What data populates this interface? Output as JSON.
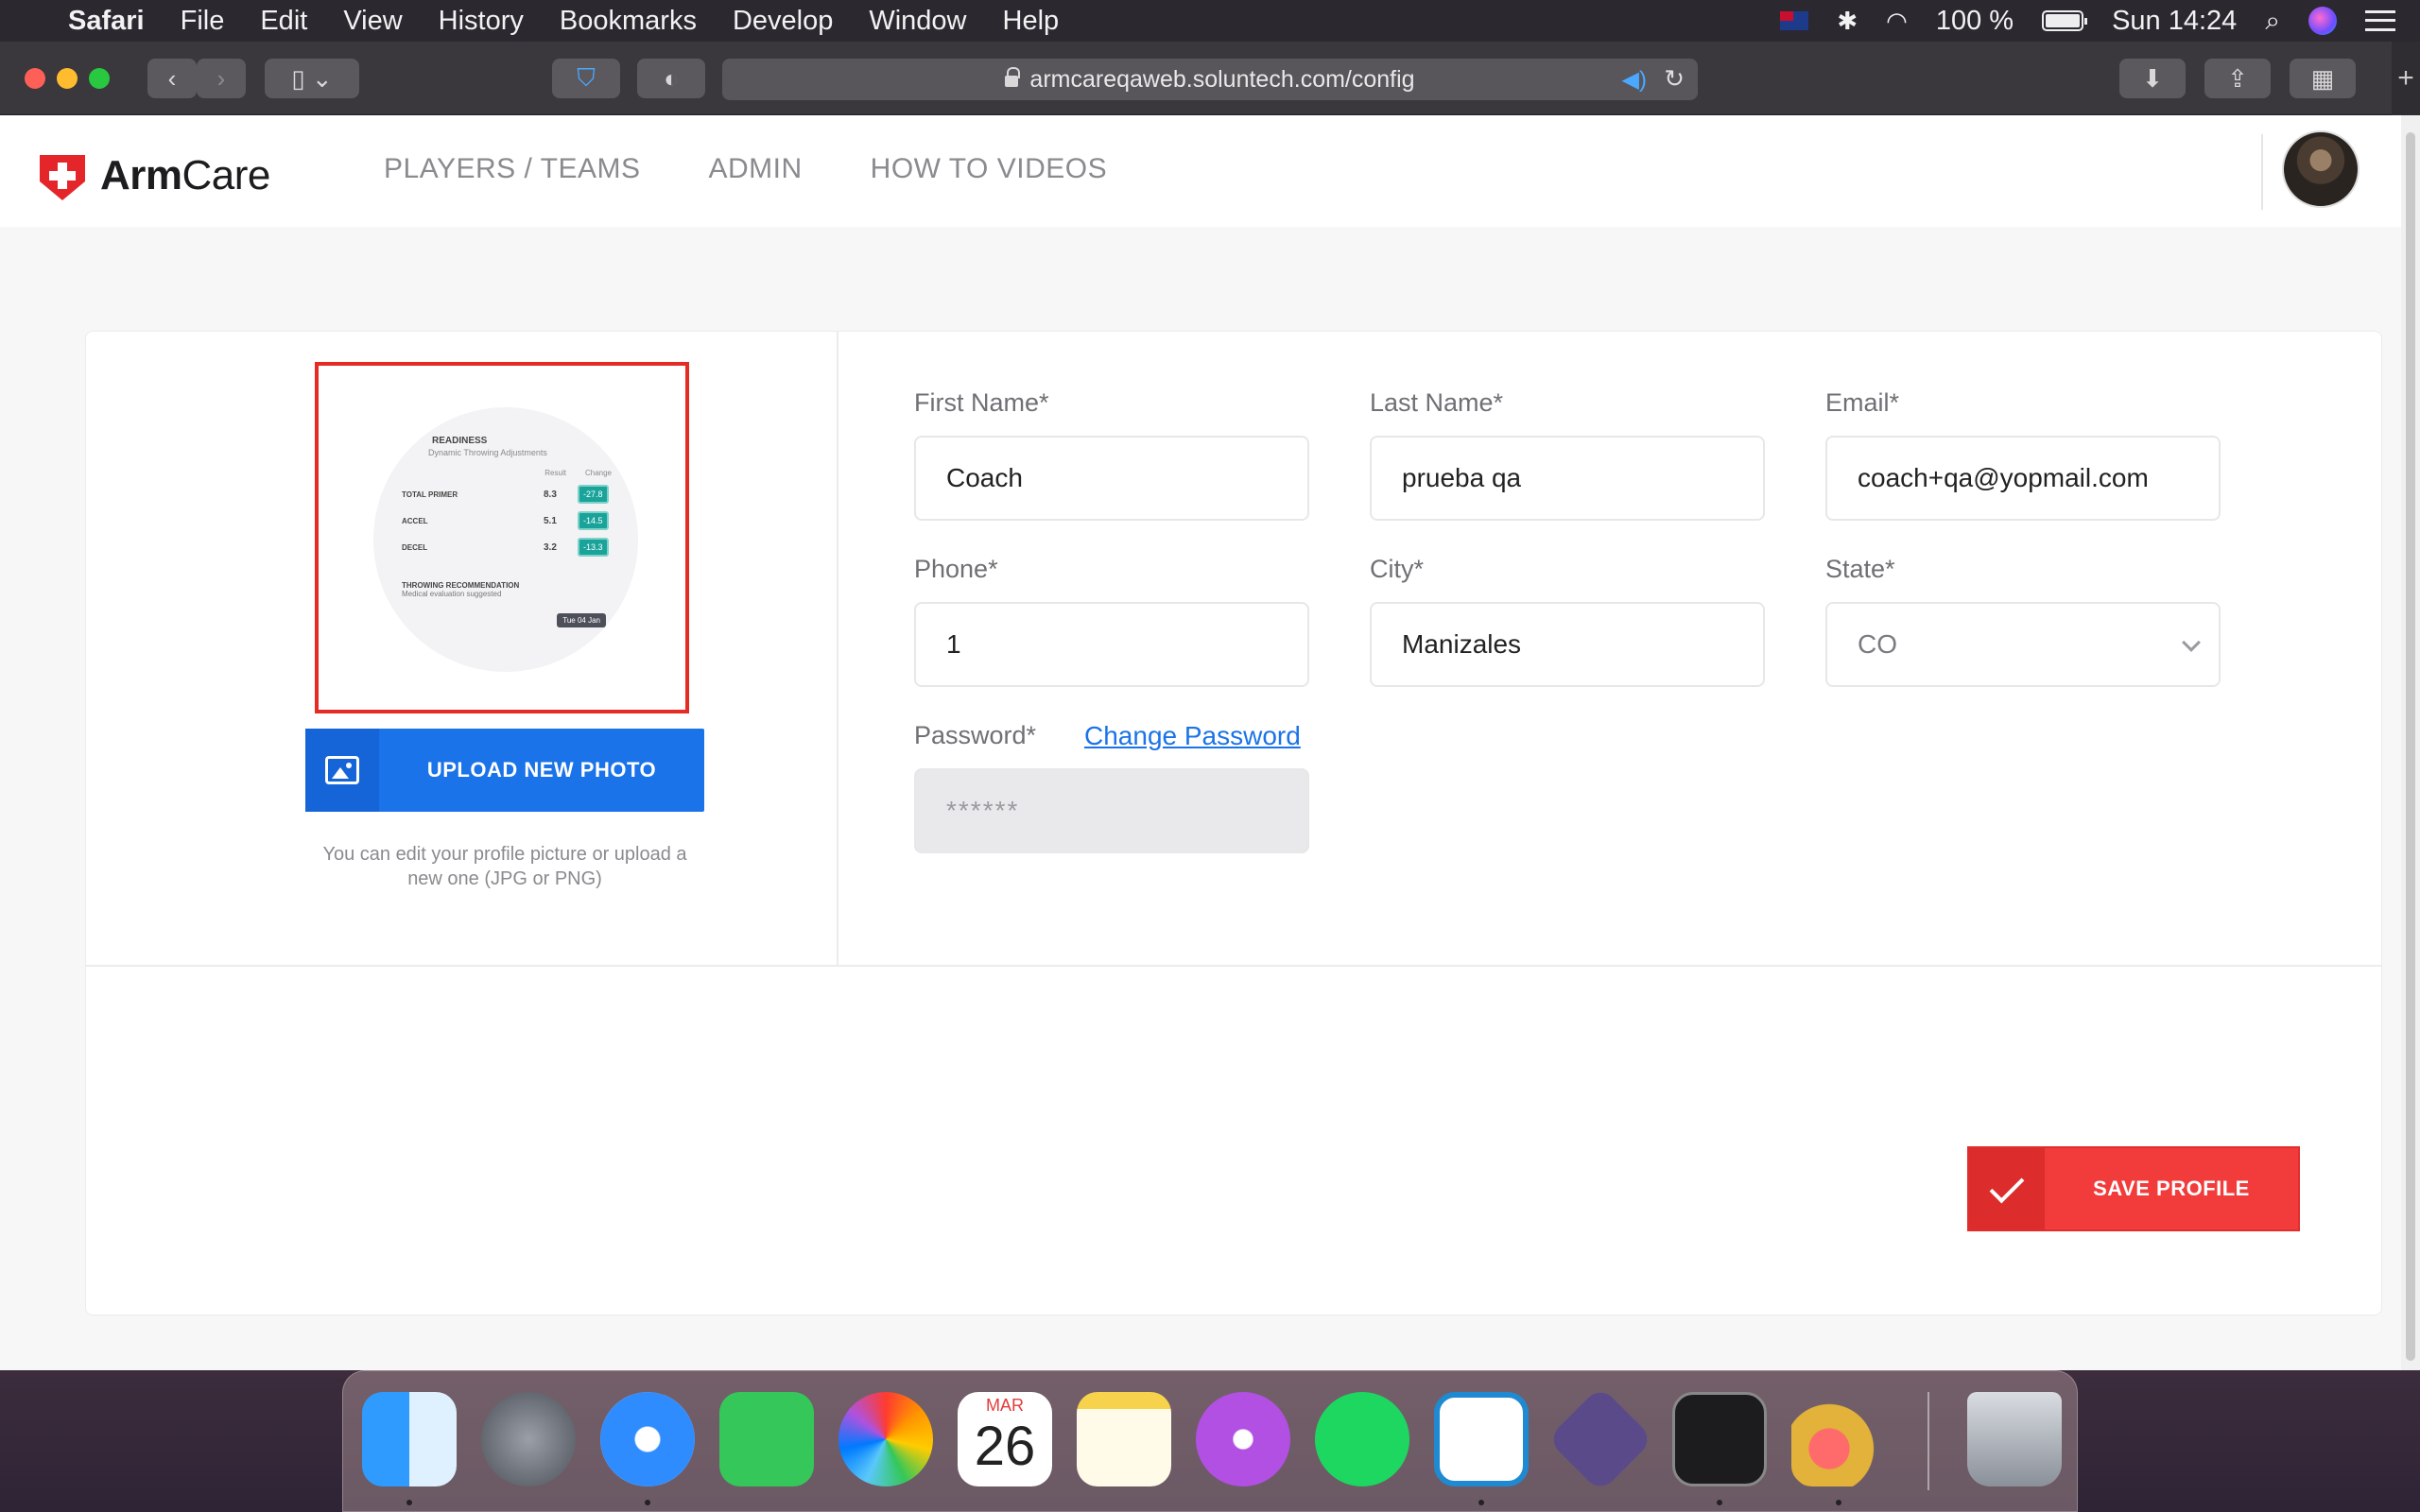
{
  "menubar": {
    "app_name": "Safari",
    "items": [
      "File",
      "Edit",
      "View",
      "History",
      "Bookmarks",
      "Develop",
      "Window",
      "Help"
    ],
    "battery": "100 %",
    "clock": "Sun 14:24"
  },
  "browser": {
    "url": "armcareqaweb.soluntech.com/config"
  },
  "app": {
    "brand_bold": "Arm",
    "brand_light": "Care",
    "nav": [
      "PLAYERS / TEAMS",
      "ADMIN",
      "HOW TO VIDEOS"
    ]
  },
  "profile_photo": {
    "title": "READINESS",
    "subtitle": "Dynamic Throwing Adjustments",
    "col_result": "Result",
    "col_change": "Change",
    "rows": [
      {
        "label": "TOTAL PRIMER",
        "value": "8.3",
        "change": "-27.8"
      },
      {
        "label": "ACCEL",
        "value": "5.1",
        "change": "-14.5"
      },
      {
        "label": "DECEL",
        "value": "3.2",
        "change": "-13.3"
      }
    ],
    "recommendation": "THROWING RECOMMENDATION",
    "recommendation_detail": "Medical evaluation suggested",
    "date": "Tue 04 Jan"
  },
  "upload": {
    "button_label": "UPLOAD NEW PHOTO",
    "hint": "You can edit your profile picture or upload a new one (JPG or PNG)"
  },
  "form": {
    "first_name": {
      "label": "First Name*",
      "value": "Coach"
    },
    "last_name": {
      "label": "Last Name*",
      "value": "prueba qa"
    },
    "email": {
      "label": "Email*",
      "value": "coach+qa@yopmail.com"
    },
    "phone": {
      "label": "Phone*",
      "value": "1"
    },
    "city": {
      "label": "City*",
      "value": "Manizales"
    },
    "state": {
      "label": "State*",
      "value": "CO"
    },
    "password": {
      "label": "Password*",
      "value": "******",
      "change_link": "Change Password"
    }
  },
  "save_button": "SAVE PROFILE",
  "dock": {
    "calendar_month": "MAR",
    "calendar_day": "26"
  },
  "colors": {
    "accent_blue": "#1a73e8",
    "accent_red": "#f23c3c",
    "highlight_border": "#e42c25"
  }
}
